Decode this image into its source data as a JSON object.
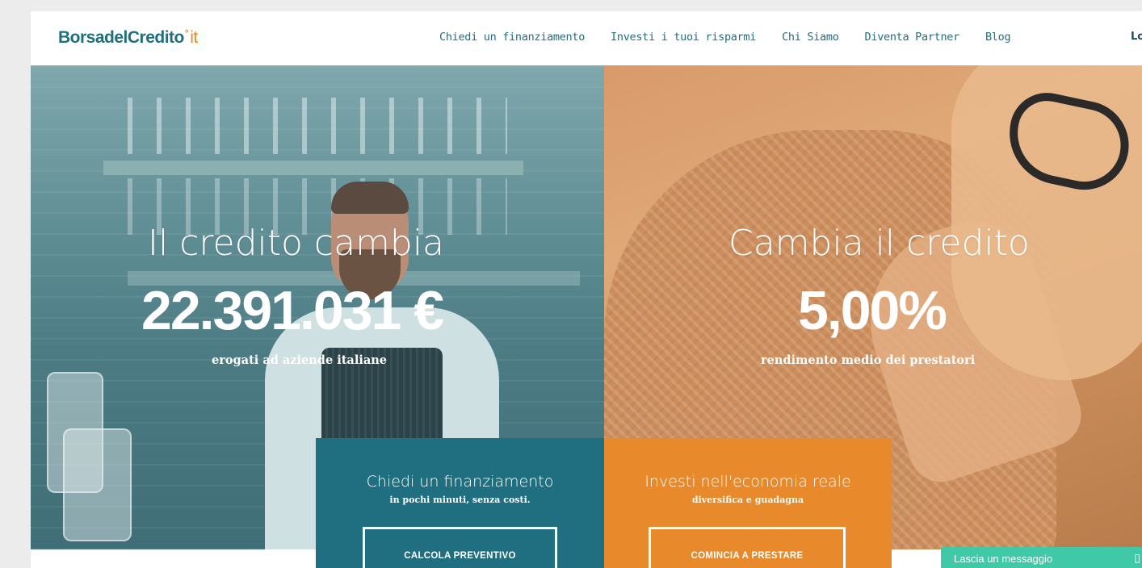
{
  "brand": {
    "logo_main": "BorsadelCredito",
    "logo_dot": "°",
    "logo_tld": "it",
    "primary_color": "#1f6f80",
    "accent_color": "#e8892c"
  },
  "nav": {
    "items": [
      {
        "label": "Chiedi un finanziamento"
      },
      {
        "label": "Investi i tuoi risparmi"
      },
      {
        "label": "Chi Siamo"
      },
      {
        "label": "Diventa Partner"
      },
      {
        "label": "Blog"
      }
    ],
    "login_label": "Lo"
  },
  "hero": {
    "left": {
      "title": "Il credito cambia",
      "number": "22.391.031 €",
      "subtitle": "erogati ad aziende italiane"
    },
    "right": {
      "title": "Cambia il credito",
      "number": "5,00%",
      "subtitle": "rendimento medio dei prestatori"
    }
  },
  "cta": {
    "left": {
      "title": "Chiedi un finanziamento",
      "subtitle": "in pochi minuti, senza costi.",
      "button": "CALCOLA PREVENTIVO"
    },
    "right": {
      "title": "Investi nell'economia reale",
      "subtitle": "diversifica e guadagna",
      "button": "COMINCIA A PRESTARE"
    }
  },
  "chat": {
    "label": "Lascia un messaggio",
    "icon": "chat-icon"
  }
}
